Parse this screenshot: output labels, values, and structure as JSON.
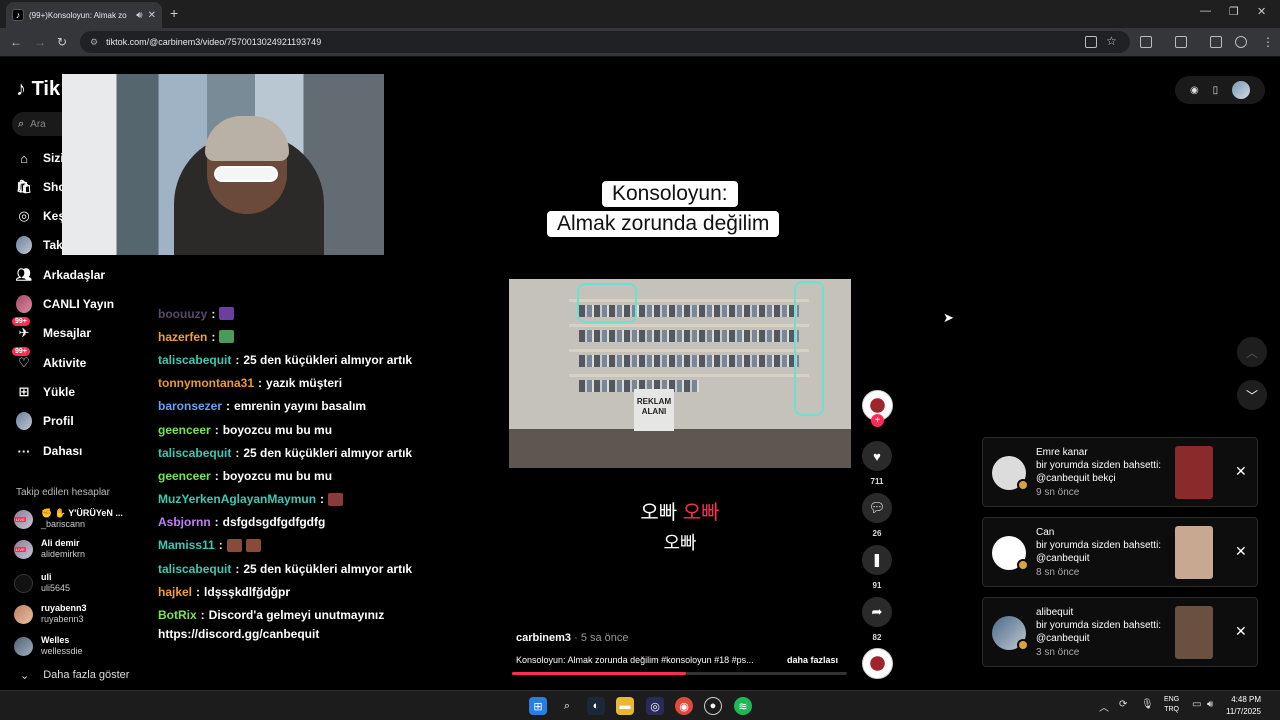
{
  "browser": {
    "tab_title": "(99+)Konsoloyun: Almak zo",
    "url": "tiktok.com/@carbinem3/video/7570013024921193749"
  },
  "tiktok": {
    "logo_text": "Tik",
    "search_placeholder": "Ara",
    "nav": [
      {
        "label": "Sizin",
        "icon": "home-icon"
      },
      {
        "label": "Shop",
        "icon": "shop-icon"
      },
      {
        "label": "Keşfet",
        "icon": "explore-icon"
      },
      {
        "label": "Takip",
        "icon": "following-avatar"
      },
      {
        "label": "Arkadaşlar",
        "icon": "friends-icon"
      },
      {
        "label": "CANLI Yayın",
        "icon": "live-icon"
      },
      {
        "label": "Mesajlar",
        "icon": "messages-icon",
        "badge": "99+"
      },
      {
        "label": "Aktivite",
        "icon": "activity-icon",
        "badge": "99+"
      },
      {
        "label": "Yükle",
        "icon": "upload-icon"
      },
      {
        "label": "Profil",
        "icon": "profile-avatar"
      },
      {
        "label": "Dahası",
        "icon": "more-icon"
      }
    ],
    "following_title": "Takip edilen hesaplar",
    "following": [
      {
        "name": "✊ ✋ Y'ÜRÜYeN ...",
        "handle": "_bariscann",
        "live": true
      },
      {
        "name": "Ali demir",
        "handle": "alidemirkrn",
        "live": true
      },
      {
        "name": "uli",
        "handle": "uli5645",
        "live": false
      },
      {
        "name": "ruyabenn3",
        "handle": "ruyabenn3",
        "live": false
      },
      {
        "name": "Welles",
        "handle": "wellessdie",
        "live": false
      }
    ],
    "show_more": "Daha fazla göster"
  },
  "chat": [
    {
      "user": "boouuzy",
      "color": "#5a4a6a",
      "text": "",
      "emotes": [
        "#6a3fa0"
      ]
    },
    {
      "user": "hazerfen",
      "color": "#f0a030",
      "text": "",
      "emotes": [
        "#4a9a5a"
      ]
    },
    {
      "user": "taliscabequit",
      "color": "#3cc8b4",
      "text": "25 den küçükleri almıyor artık",
      "emotes": []
    },
    {
      "user": "tonnymontana31",
      "color": "#e89a2a",
      "text": "yazık müşteri",
      "emotes": []
    },
    {
      "user": "baronsezer",
      "color": "#6aa0f0",
      "text": "emrenin yayını basalım",
      "emotes": []
    },
    {
      "user": "geenceer",
      "color": "#7ce05a",
      "text": "boyozcu mu bu mu",
      "emotes": []
    },
    {
      "user": "taliscabequit",
      "color": "#3cc8b4",
      "text": "25 den küçükleri almıyor artık",
      "emotes": []
    },
    {
      "user": "geenceer",
      "color": "#7ce05a",
      "text": "boyozcu mu bu mu",
      "emotes": []
    },
    {
      "user": "MuzYerkenAglayanMaymun",
      "color": "#3cc8b4",
      "text": "",
      "emotes": [
        "#8a3a3a"
      ]
    },
    {
      "user": "Asbjornn",
      "color": "#c080f0",
      "text": "dsfgdsgdfgdfgdfg",
      "emotes": []
    },
    {
      "user": "Mamiss11",
      "color": "#3cc8b4",
      "text": "",
      "emotes": [
        "#8a4a3a",
        "#8a4a3a"
      ]
    },
    {
      "user": "taliscabequit",
      "color": "#3cc8b4",
      "text": "25 den küçükleri almıyor artık",
      "emotes": []
    },
    {
      "user": "hajkel",
      "color": "#f0a030",
      "text": "ldşsşkdlfğdğpr",
      "emotes": []
    },
    {
      "user": "BotRix",
      "color": "#7ce05a",
      "text": "Discord'a gelmeyi unutmayınız",
      "emotes": []
    }
  ],
  "chat_link": "https://discord.gg/canbequit",
  "video": {
    "caption_line1": "Konsoloyun:",
    "caption_line2": "Almak zorunda değilim",
    "sign_text": "REKLAM ALANI",
    "subtitle_a": "오빠",
    "subtitle_b": "오빠",
    "subtitle_c": "오빠",
    "author": "carbinem3",
    "time": "· 5 sa önce",
    "description": "Konsoloyun: Almak zorunda değilim #konsoloyun #18 #ps...",
    "more_label": "daha fazlası",
    "progress": 0.52
  },
  "actions": {
    "likes": "711",
    "comments": "26",
    "saves": "91",
    "shares": "82"
  },
  "notifications": [
    {
      "name": "Emre kanar",
      "line1": "bir yorumda sizden bahsetti:",
      "line2": "@canbequit bekçi",
      "ago": "9 sn önce",
      "thumb": "#8a2a2a"
    },
    {
      "name": "Can",
      "line1": "bir yorumda sizden bahsetti:",
      "line2": "@canbequit",
      "ago": "8 sn önce",
      "thumb": "#c8a890"
    },
    {
      "name": "alibequit",
      "line1": "bir yorumda sizden bahsetti:",
      "line2": "@canbequit",
      "ago": "3 sn önce",
      "thumb": "#6a5040"
    }
  ],
  "taskbar": {
    "lang_top": "ENG",
    "lang_bottom": "TRQ",
    "time": "4:48 PM",
    "date": "11/7/2025"
  }
}
